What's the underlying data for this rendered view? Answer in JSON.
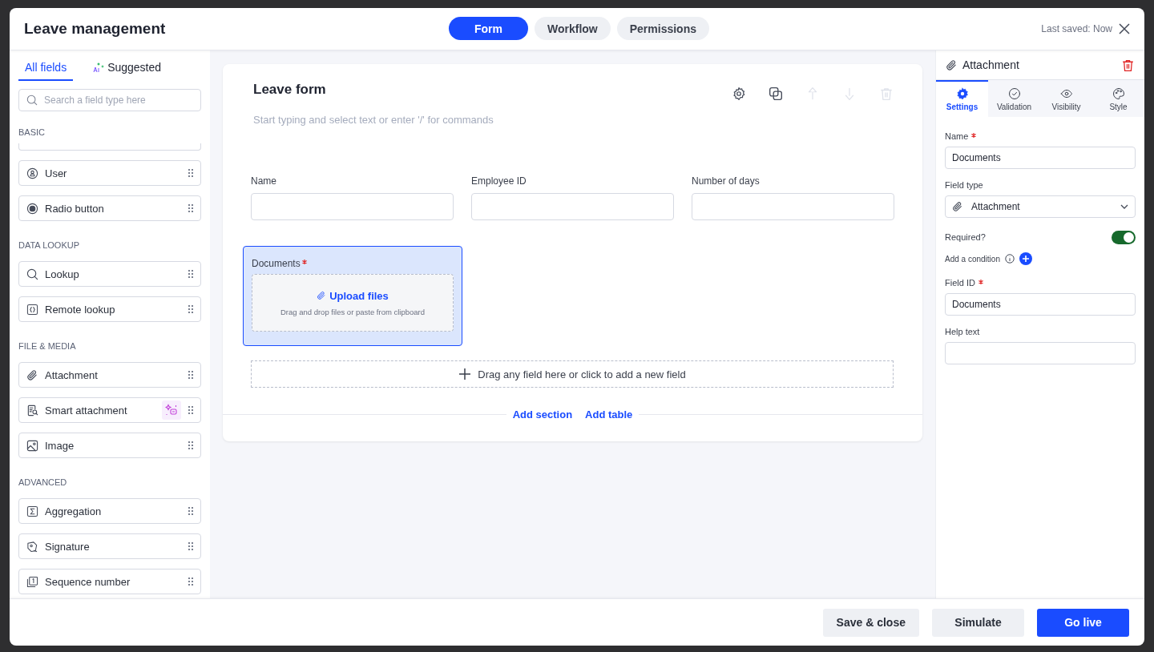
{
  "window": {
    "title": "Leave management",
    "last_saved": "Last saved: Now"
  },
  "tabs": [
    {
      "label": "Form",
      "selected": true
    },
    {
      "label": "Workflow",
      "selected": false
    },
    {
      "label": "Permissions",
      "selected": false
    }
  ],
  "sidebar": {
    "tabs": [
      {
        "label": "All fields",
        "selected": true,
        "kind": "plain"
      },
      {
        "label": "Suggested",
        "selected": false,
        "kind": "ai"
      }
    ],
    "search": {
      "placeholder": "Search a field type here"
    },
    "groups": [
      {
        "title": "BASIC",
        "clipped_top": true,
        "items": [
          {
            "label": "User",
            "kind": "user",
            "ai_badge": false
          },
          {
            "label": "Radio button",
            "kind": "radio",
            "ai_badge": false
          }
        ]
      },
      {
        "title": "DATA LOOKUP",
        "clipped_top": false,
        "items": [
          {
            "label": "Lookup",
            "kind": "search",
            "ai_badge": false
          },
          {
            "label": "Remote lookup",
            "kind": "braces",
            "ai_badge": false
          }
        ]
      },
      {
        "title": "FILE & MEDIA",
        "clipped_top": false,
        "items": [
          {
            "label": "Attachment",
            "kind": "clip",
            "ai_badge": false
          },
          {
            "label": "Smart attachment",
            "kind": "smartdoc",
            "ai_badge": true
          },
          {
            "label": "Image",
            "kind": "image",
            "ai_badge": false
          }
        ]
      },
      {
        "title": "ADVANCED",
        "clipped_top": false,
        "items": [
          {
            "label": "Aggregation",
            "kind": "sigma",
            "ai_badge": false
          },
          {
            "label": "Signature",
            "kind": "signature",
            "ai_badge": false
          },
          {
            "label": "Sequence number",
            "kind": "sequence",
            "ai_badge": false
          }
        ]
      }
    ]
  },
  "form": {
    "title": "Leave form",
    "placeholder": "Start typing and select text or enter '/' for commands",
    "toolbar": [
      {
        "kind": "gear",
        "disabled": false
      },
      {
        "kind": "copy",
        "disabled": false
      },
      {
        "kind": "up",
        "disabled": true
      },
      {
        "kind": "down",
        "disabled": true
      },
      {
        "kind": "trash",
        "disabled": true
      }
    ],
    "fields": [
      {
        "label": "Name",
        "kind": "text",
        "required": false,
        "selected": false
      },
      {
        "label": "Employee ID",
        "kind": "text",
        "required": false,
        "selected": false
      },
      {
        "label": "Number of days",
        "kind": "text",
        "required": false,
        "selected": false
      },
      {
        "label": "Documents",
        "kind": "upload",
        "required": true,
        "selected": true,
        "upload_label": "Upload files",
        "upload_hint": "Drag and drop files or paste from clipboard"
      }
    ],
    "add_field": "Drag any field here or click to add a new field",
    "links": [
      "Add section",
      "Add table"
    ]
  },
  "properties": {
    "title": "Attachment",
    "tabs": [
      {
        "label": "Settings",
        "kind": "gear",
        "selected": true
      },
      {
        "label": "Validation",
        "kind": "check",
        "selected": false
      },
      {
        "label": "Visibility",
        "kind": "eye",
        "selected": false
      },
      {
        "label": "Style",
        "kind": "palette",
        "selected": false
      }
    ],
    "name": {
      "label": "Name",
      "required": true,
      "value": "Documents"
    },
    "field_type": {
      "label": "Field type",
      "value": "Attachment"
    },
    "required": {
      "label": "Required?",
      "on": true
    },
    "condition": "Add a condition",
    "field_id": {
      "label": "Field ID",
      "required": true,
      "value": "Documents"
    },
    "help_text": {
      "label": "Help text"
    }
  },
  "footer": [
    {
      "label": "Save & close",
      "kind": "secondary"
    },
    {
      "label": "Simulate",
      "kind": "secondary"
    },
    {
      "label": "Go live",
      "kind": "primary"
    }
  ]
}
